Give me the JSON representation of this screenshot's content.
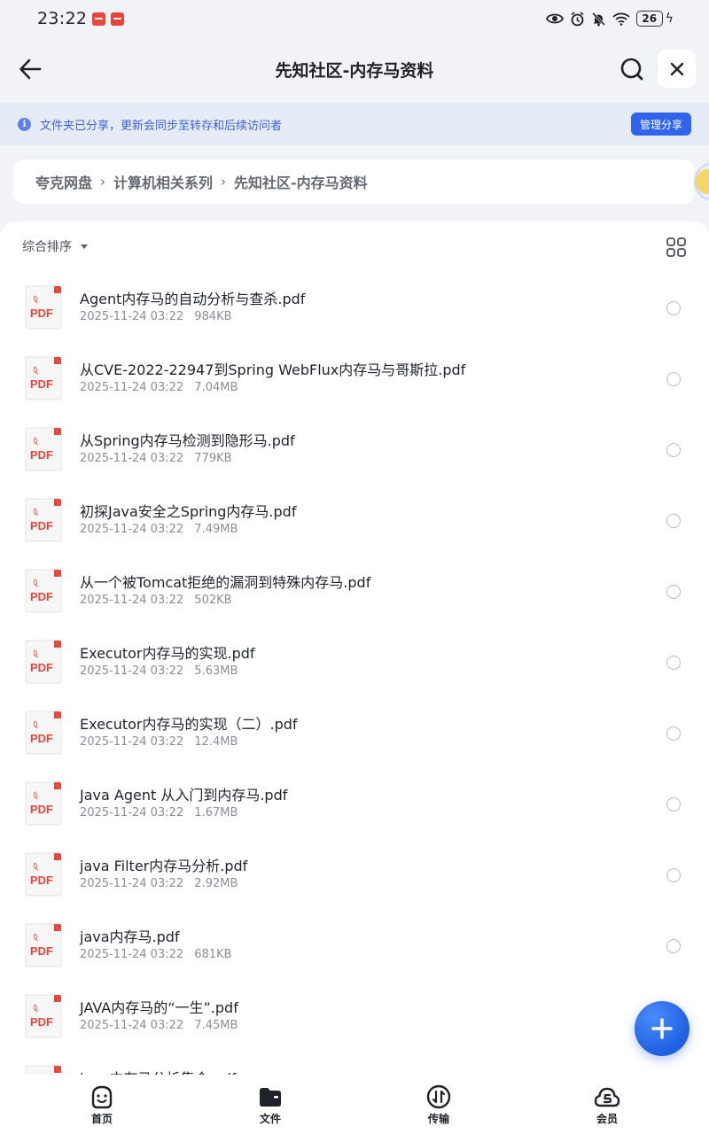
{
  "status_bar": {
    "time": "23:22",
    "battery": "26"
  },
  "header": {
    "title": "先知社区-内存马资料"
  },
  "share_banner": {
    "info_icon_label": "i",
    "text": "文件夹已分享，更新会同步至转存和后续访问者",
    "manage_label": "管理分享"
  },
  "breadcrumb": {
    "items": [
      "夸克网盘",
      "计算机相关系列",
      "先知社区-内存马资料"
    ],
    "separator": "›"
  },
  "toolbar": {
    "sort_label": "综合排序"
  },
  "files": [
    {
      "name": "Agent内存马的自动分析与查杀.pdf",
      "date": "2025-11-24 03:22",
      "size": "984KB",
      "type_label": "PDF"
    },
    {
      "name": "从CVE-2022-22947到Spring WebFlux内存马与哥斯拉.pdf",
      "date": "2025-11-24 03:22",
      "size": "7.04MB",
      "type_label": "PDF"
    },
    {
      "name": "从Spring内存马检测到隐形马.pdf",
      "date": "2025-11-24 03:22",
      "size": "779KB",
      "type_label": "PDF"
    },
    {
      "name": "初探Java安全之Spring内存马.pdf",
      "date": "2025-11-24 03:22",
      "size": "7.49MB",
      "type_label": "PDF"
    },
    {
      "name": "从一个被Tomcat拒绝的漏洞到特殊内存马.pdf",
      "date": "2025-11-24 03:22",
      "size": "502KB",
      "type_label": "PDF"
    },
    {
      "name": "Executor内存马的实现.pdf",
      "date": "2025-11-24 03:22",
      "size": "5.63MB",
      "type_label": "PDF"
    },
    {
      "name": "Executor内存马的实现（二）.pdf",
      "date": "2025-11-24 03:22",
      "size": "12.4MB",
      "type_label": "PDF"
    },
    {
      "name": "Java Agent 从入门到内存马.pdf",
      "date": "2025-11-24 03:22",
      "size": "1.67MB",
      "type_label": "PDF"
    },
    {
      "name": "java Filter内存马分析.pdf",
      "date": "2025-11-24 03:22",
      "size": "2.92MB",
      "type_label": "PDF"
    },
    {
      "name": "java内存马.pdf",
      "date": "2025-11-24 03:22",
      "size": "681KB",
      "type_label": "PDF"
    },
    {
      "name": "JAVA内存马的“一生”.pdf",
      "date": "2025-11-24 03:22",
      "size": "7.45MB",
      "type_label": "PDF"
    },
    {
      "name": "java内存马分析集合.pdf",
      "date": "",
      "size": "",
      "type_label": "PDF"
    }
  ],
  "bottom_nav": {
    "items": [
      {
        "label": "首页",
        "icon": "home-face-icon"
      },
      {
        "label": "文件",
        "icon": "folder-icon"
      },
      {
        "label": "传输",
        "icon": "transfer-icon"
      },
      {
        "label": "会员",
        "icon": "vip-cloud-icon"
      }
    ]
  },
  "colors": {
    "accent": "#3164e8",
    "banner_bg": "#e6ebf8",
    "pdf_red": "#e8453c"
  }
}
